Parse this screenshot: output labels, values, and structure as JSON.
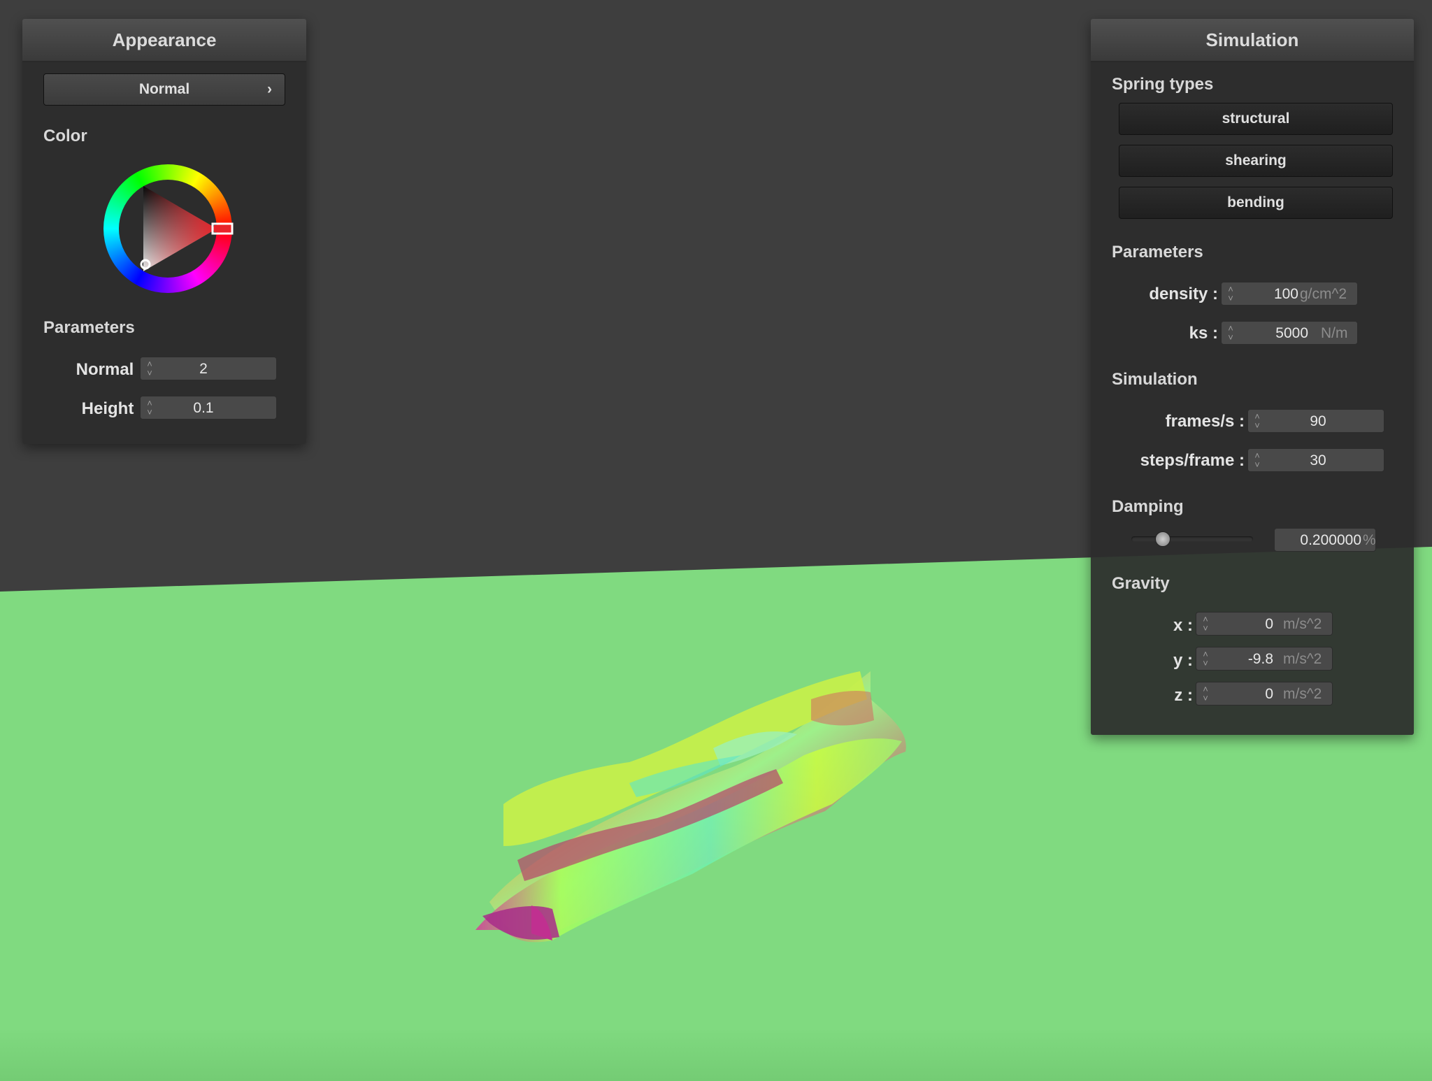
{
  "appearance": {
    "title": "Appearance",
    "mode_label": "Normal",
    "mode_chevron": "›",
    "color_title": "Color",
    "selected_color": "#e8242a",
    "parameters_title": "Parameters",
    "normal_label": "Normal :",
    "normal_value": "2",
    "height_label": "Height :",
    "height_value": "0.1"
  },
  "simulation": {
    "title": "Simulation",
    "spring_types_title": "Spring types",
    "spring_structural": "structural",
    "spring_shearing": "shearing",
    "spring_bending": "bending",
    "parameters_title": "Parameters",
    "density_label": "density :",
    "density_value": "100",
    "density_unit": "g/cm^2",
    "ks_label": "ks :",
    "ks_value": "5000",
    "ks_unit": "N/m",
    "simulation_title": "Simulation",
    "fps_label": "frames/s :",
    "fps_value": "90",
    "steps_label": "steps/frame :",
    "steps_value": "30",
    "damping_title": "Damping",
    "damping_value": "0.200000",
    "damping_unit": "%",
    "damping_level": 0.2,
    "gravity_title": "Gravity",
    "gx_label": "x :",
    "gx_value": "0",
    "gy_label": "y :",
    "gy_value": "-9.8",
    "gz_label": "z :",
    "gz_value": "0",
    "gravity_unit": "m/s^2"
  },
  "colors": {
    "sky": "#3e3e3e",
    "floor": "#80da80",
    "panel": "#2c2c2c",
    "accent_red": "#e8242a"
  },
  "icons": {
    "spinner": "up-down-arrows-icon",
    "chevron": "chevron-right-icon"
  }
}
